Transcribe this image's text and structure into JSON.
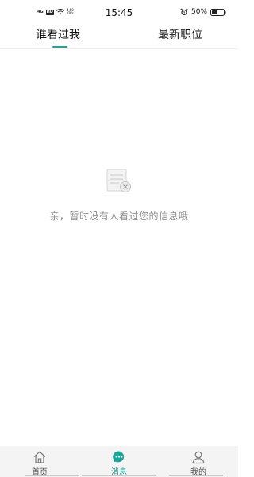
{
  "status_bar": {
    "network": "4G",
    "hd": "HD",
    "speed_value": "4.50",
    "speed_unit": "KB/s",
    "time": "15:45",
    "battery": "50%"
  },
  "tabs": [
    {
      "label": "谁看过我",
      "active": true
    },
    {
      "label": "最新职位",
      "active": false
    }
  ],
  "empty_state": {
    "message": "亲，暂时没有人看过您的信息哦"
  },
  "bottom_nav": [
    {
      "label": "首页",
      "icon": "home-icon",
      "active": false
    },
    {
      "label": "消息",
      "icon": "message-icon",
      "active": true
    },
    {
      "label": "我的",
      "icon": "user-icon",
      "active": false
    }
  ],
  "colors": {
    "accent": "#1aa697",
    "empty_text": "#8e8e8e",
    "nav_background": "#f4f4f4"
  }
}
